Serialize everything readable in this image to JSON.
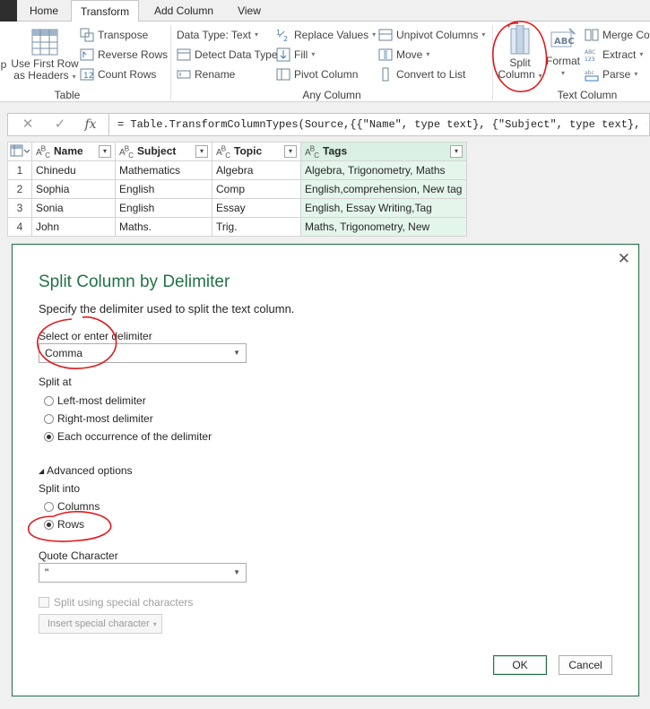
{
  "tabs": [
    "Home",
    "Transform",
    "Add Column",
    "View"
  ],
  "ribbon": {
    "table_group": {
      "label": "Table",
      "use_first_row": [
        "Use First Row",
        "as Headers"
      ],
      "transpose": "Transpose",
      "reverse_rows": "Reverse Rows",
      "count_rows": "Count Rows"
    },
    "any_column_group": {
      "label": "Any Column",
      "data_type": "Data Type: Text",
      "detect_data_type": "Detect Data Type",
      "rename": "Rename",
      "replace_values": "Replace Values",
      "fill": "Fill",
      "pivot_column": "Pivot Column",
      "unpivot_columns": "Unpivot Columns",
      "move": "Move",
      "convert_to_list": "Convert to List"
    },
    "text_column_group": {
      "label": "Text Column",
      "split_column": [
        "Split",
        "Column"
      ],
      "format": "Format",
      "merge_columns": "Merge Col",
      "extract": "Extract",
      "parse": "Parse"
    }
  },
  "formula": {
    "fx": "fx",
    "text": "= Table.TransformColumnTypes(Source,{{\"Name\", type text}, {\"Subject\", type text}, {\"Topic\", type text}, {\"Tags\", type text}})"
  },
  "table": {
    "columns": [
      "Name",
      "Subject",
      "Topic",
      "Tags"
    ],
    "rows": [
      [
        "1",
        "Chinedu",
        "Mathematics",
        "Algebra",
        "Algebra, Trigonometry,  Maths"
      ],
      [
        "2",
        "Sophia",
        "English",
        "Comp",
        "English,comprehension, New tag"
      ],
      [
        "3",
        "Sonia",
        "English",
        "Essay",
        "English, Essay Writing,Tag"
      ],
      [
        "4",
        "John",
        "Maths.",
        "Trig.",
        "Maths, Trigonometry, New"
      ]
    ]
  },
  "dialog": {
    "title": "Split Column by Delimiter",
    "subtitle": "Specify the delimiter used to split the text column.",
    "delimiter_label": "Select or enter delimiter",
    "delimiter_value": "Comma",
    "split_at_label": "Split at",
    "split_at_options": [
      "Left-most delimiter",
      "Right-most delimiter",
      "Each occurrence of the delimiter"
    ],
    "split_at_selected": 2,
    "advanced_label": "Advanced options",
    "split_into_label": "Split into",
    "split_into_options": [
      "Columns",
      "Rows"
    ],
    "split_into_selected": 1,
    "quote_char_label": "Quote Character",
    "quote_char_value": "\"",
    "special_chars_label": "Split using special characters",
    "insert_special_label": "Insert special character",
    "ok_label": "OK",
    "cancel_label": "Cancel"
  },
  "colors": {
    "accent_green": "#217346",
    "highlight_column": "#e4f5eb",
    "annotation_red": "#e0191c"
  }
}
